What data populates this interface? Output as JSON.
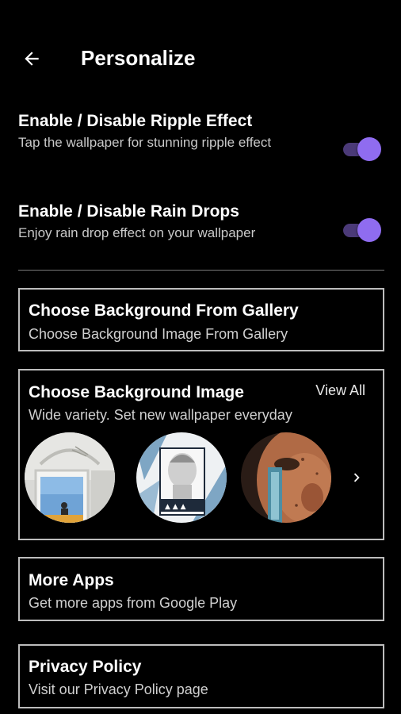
{
  "header": {
    "title": "Personalize",
    "back_icon": "arrow-left-icon"
  },
  "settings": {
    "ripple": {
      "title": "Enable / Disable Ripple Effect",
      "description": "Tap the wallpaper for stunning ripple effect",
      "enabled": true
    },
    "rain": {
      "title": "Enable / Disable Rain Drops",
      "description": "Enjoy rain drop effect on your wallpaper",
      "enabled": true
    }
  },
  "cards": {
    "gallery": {
      "title": "Choose Background From Gallery",
      "description": "Choose Background Image From Gallery"
    },
    "background": {
      "title": "Choose Background Image",
      "description": "Wide variety. Set new wallpaper everyday",
      "view_all": "View All",
      "thumbnails": [
        "wallpaper-thumbnail-arch",
        "wallpaper-thumbnail-statue",
        "wallpaper-thumbnail-face"
      ]
    },
    "more_apps": {
      "title": "More Apps",
      "description": "Get more apps from Google Play"
    },
    "privacy": {
      "title": "Privacy Policy",
      "description": "Visit our Privacy Policy page"
    }
  },
  "colors": {
    "background": "#000000",
    "accent": "#8f6cf0",
    "accent_track": "#4b3a78",
    "card_border": "#bdbdbd"
  }
}
